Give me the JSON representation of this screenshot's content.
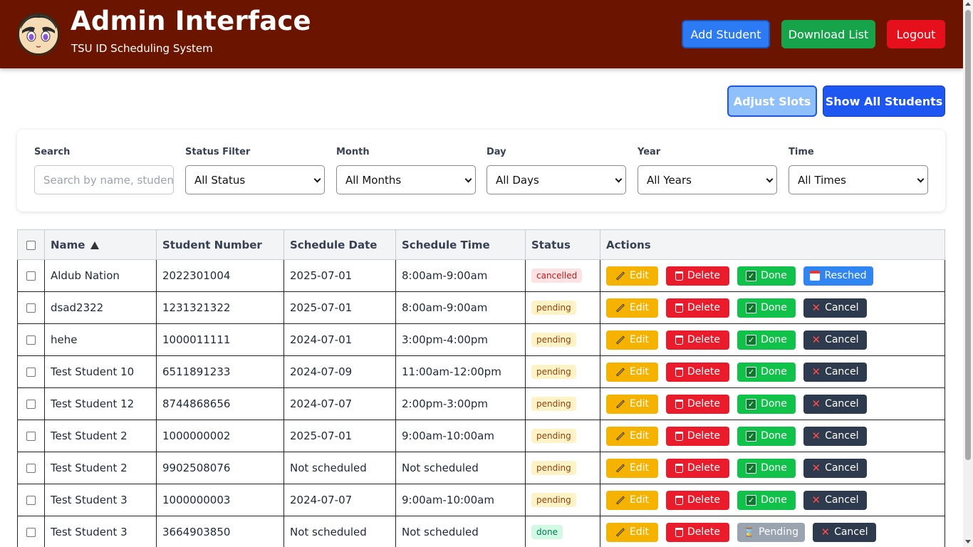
{
  "header": {
    "title": "Admin Interface",
    "subtitle": "TSU ID Scheduling System",
    "logo_icon": "anime-avatar-logo",
    "buttons": {
      "add_student": "Add Student",
      "download_list": "Download List",
      "logout": "Logout"
    }
  },
  "toolbar": {
    "adjust_slots": "Adjust Slots",
    "show_all_students": "Show All Students"
  },
  "filters": {
    "search": {
      "label": "Search",
      "placeholder": "Search by name, student number"
    },
    "status": {
      "label": "Status Filter",
      "value": "All Status"
    },
    "month": {
      "label": "Month",
      "value": "All Months"
    },
    "day": {
      "label": "Day",
      "value": "All Days"
    },
    "year": {
      "label": "Year",
      "value": "All Years"
    },
    "time": {
      "label": "Time",
      "value": "All Times"
    }
  },
  "table": {
    "columns": [
      "Name",
      "Student Number",
      "Schedule Date",
      "Schedule Time",
      "Status",
      "Actions"
    ],
    "sort": {
      "column": "Name",
      "direction": "ascending"
    },
    "action_labels": {
      "edit": "Edit",
      "delete": "Delete",
      "done": "Done",
      "resched": "Resched",
      "cancel": "Cancel",
      "pending": "Pending"
    },
    "rows": [
      {
        "name": "Aldub Nation",
        "student_number": "2022301004",
        "date": "2025-07-01",
        "time": "8:00am-9:00am",
        "status": "cancelled"
      },
      {
        "name": "dsad2322",
        "student_number": "1231321322",
        "date": "2025-07-01",
        "time": "8:00am-9:00am",
        "status": "pending"
      },
      {
        "name": "hehe",
        "student_number": "1000011111",
        "date": "2024-07-01",
        "time": "3:00pm-4:00pm",
        "status": "pending"
      },
      {
        "name": "Test Student 10",
        "student_number": "6511891233",
        "date": "2024-07-09",
        "time": "11:00am-12:00pm",
        "status": "pending"
      },
      {
        "name": "Test Student 12",
        "student_number": "8744868656",
        "date": "2024-07-07",
        "time": "2:00pm-3:00pm",
        "status": "pending"
      },
      {
        "name": "Test Student 2",
        "student_number": "1000000002",
        "date": "2025-07-01",
        "time": "9:00am-10:00am",
        "status": "pending"
      },
      {
        "name": "Test Student 2",
        "student_number": "9902508076",
        "date": "Not scheduled",
        "time": "Not scheduled",
        "status": "pending"
      },
      {
        "name": "Test Student 3",
        "student_number": "1000000003",
        "date": "2024-07-07",
        "time": "9:00am-10:00am",
        "status": "pending"
      },
      {
        "name": "Test Student 3",
        "student_number": "3664903850",
        "date": "Not scheduled",
        "time": "Not scheduled",
        "status": "done"
      }
    ]
  },
  "colors": {
    "header_bg": "#6b1500",
    "add_button": "#2d7bf4",
    "download_button": "#16a34a",
    "logout_button": "#e5101b",
    "edit_button": "#f5b300",
    "delete_button": "#ea1b2a",
    "done_button": "#11c24a",
    "cancel_button": "#2e3a4d",
    "resched_button": "#2f86f2"
  }
}
